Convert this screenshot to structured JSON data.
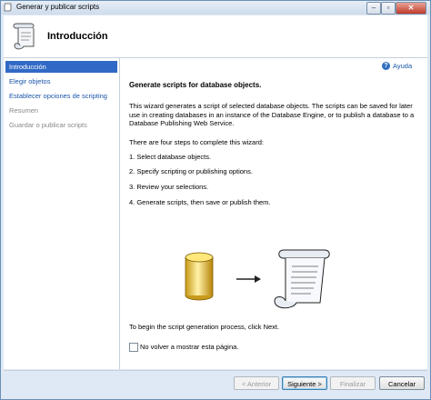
{
  "window": {
    "title": "Generar y publicar scripts"
  },
  "header": {
    "title": "Introducción"
  },
  "sidebar": {
    "items": [
      {
        "label": "Introducción",
        "state": "active"
      },
      {
        "label": "Elegir objetos",
        "state": "link"
      },
      {
        "label": "Establecer opciones de scripting",
        "state": "link"
      },
      {
        "label": "Resumen",
        "state": "disabled"
      },
      {
        "label": "Guardar o publicar scripts",
        "state": "disabled"
      }
    ]
  },
  "main": {
    "help_label": "Ayuda",
    "heading": "Generate scripts for database objects.",
    "description": "This wizard generates a script of selected database objects. The scripts can be saved for later use in creating databases in an instance of the Database Engine, or to publish a database to a Database Publishing Web Service.",
    "steps_intro": "There are four steps to complete this wizard:",
    "steps": [
      "1. Select database objects.",
      "2. Specify scripting or publishing options.",
      "3. Review your selections.",
      "4. Generate scripts, then save or publish them."
    ],
    "begin_text": "To begin the script generation process, click Next.",
    "checkbox_label": "No volver a mostrar esta página.",
    "checkbox_checked": false
  },
  "footer": {
    "back_label": "< Anterior",
    "next_label": "Siguiente >",
    "finish_label": "Finalizar",
    "cancel_label": "Cancelar"
  },
  "colors": {
    "accent": "#3169c6",
    "link": "#1a55a8",
    "frame": "#dfe9f5"
  },
  "icons": {
    "title": "scroll-icon",
    "header": "scroll-icon",
    "help": "help-icon",
    "illustration": [
      "database-cylinder-icon",
      "arrow-right-icon",
      "script-scroll-icon"
    ]
  }
}
